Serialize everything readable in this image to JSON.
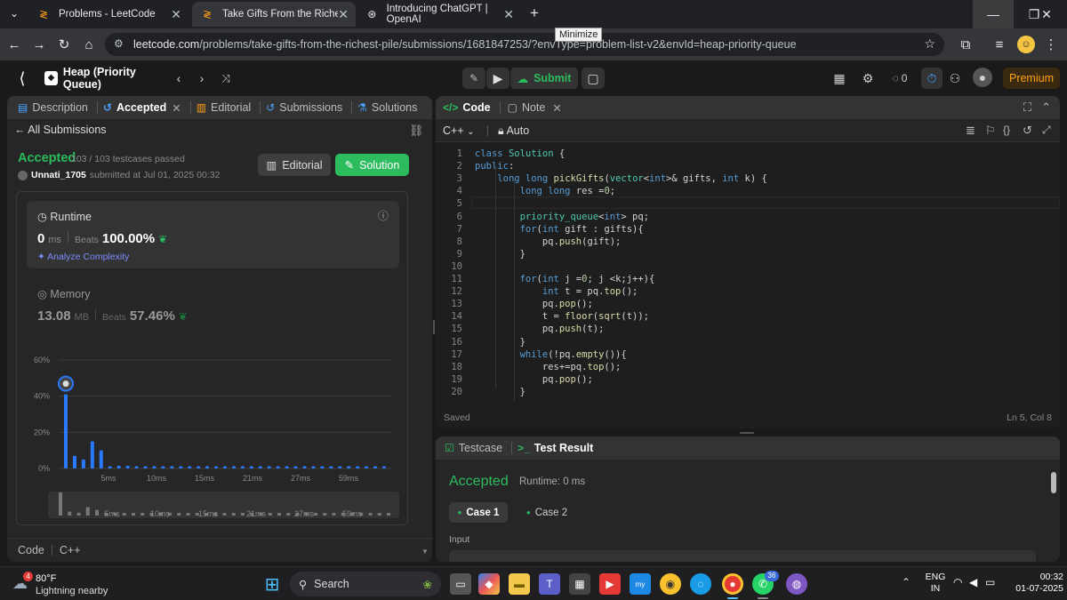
{
  "browser": {
    "tabs": [
      {
        "title": "Problems - LeetCode",
        "active": false
      },
      {
        "title": "Take Gifts From the Richest Pile",
        "active": true
      },
      {
        "title": "Introducing ChatGPT | OpenAI",
        "active": false
      }
    ],
    "tooltip": "Minimize",
    "url_host": "leetcode.com",
    "url_path": "/problems/take-gifts-from-the-richest-pile/submissions/1681847253/?envType=problem-list-v2&envId=heap-priority-queue"
  },
  "header": {
    "problem_list": "Heap (Priority Queue)",
    "submit_label": "Submit",
    "streak_count": "0",
    "premium_label": "Premium"
  },
  "left_panel": {
    "tabs": [
      {
        "label": "Description"
      },
      {
        "label": "Accepted"
      },
      {
        "label": "Editorial"
      },
      {
        "label": "Submissions"
      },
      {
        "label": "Solutions"
      }
    ],
    "back_label": "All Submissions",
    "status": "Accepted",
    "testcases": "103 / 103 testcases passed",
    "user": "Unnati_1705",
    "submitted_text": "submitted at Jul 01, 2025 00:32",
    "editorial_btn": "Editorial",
    "solution_btn": "Solution",
    "runtime": {
      "title": "Runtime",
      "value": "0",
      "unit": "ms",
      "beats_label": "Beats",
      "beats_value": "100.00%",
      "analyze": "Analyze Complexity"
    },
    "memory": {
      "title": "Memory",
      "value": "13.08",
      "unit": "MB",
      "beats_label": "Beats",
      "beats_value": "57.46%"
    },
    "footer_tabs": [
      "Code",
      "C++"
    ]
  },
  "chart_data": {
    "type": "bar",
    "y_ticks": [
      "60%",
      "40%",
      "20%",
      "0%"
    ],
    "ylim": [
      0,
      60
    ],
    "x_ticks": [
      "5ms",
      "10ms",
      "15ms",
      "21ms",
      "27ms",
      "59ms"
    ],
    "values": [
      41,
      7,
      5,
      15,
      10,
      1,
      1.5,
      1.5,
      1,
      1,
      1,
      1,
      1,
      1,
      1,
      1,
      1,
      1,
      1,
      1,
      1,
      1,
      1,
      1,
      1,
      1,
      1,
      1,
      1,
      1,
      1,
      1,
      1,
      1,
      1,
      1,
      1
    ],
    "highlight_index": 0,
    "bar_color": "#2979ff"
  },
  "code_panel": {
    "tabs": [
      {
        "label": "Code"
      },
      {
        "label": "Note"
      }
    ],
    "language": "C++",
    "auto_label": "Auto",
    "status": "Saved",
    "cursor": "Ln 5, Col 8",
    "lines": [
      "class Solution {",
      "public:",
      "    long long pickGifts(vector<int>& gifts, int k) {",
      "        long long res =0;",
      "",
      "        priority_queue<int> pq;",
      "        for(int gift : gifts){",
      "            pq.push(gift);",
      "        }",
      "",
      "        for(int j =0; j <k;j++){",
      "            int t = pq.top();",
      "            pq.pop();",
      "            t = floor(sqrt(t));",
      "            pq.push(t);",
      "        }",
      "        while(!pq.empty()){",
      "            res+=pq.top();",
      "            pq.pop();",
      "        }"
    ]
  },
  "result_panel": {
    "tabs": [
      {
        "label": "Testcase"
      },
      {
        "label": "Test Result"
      }
    ],
    "status": "Accepted",
    "runtime": "Runtime: 0 ms",
    "cases": [
      "Case 1",
      "Case 2"
    ],
    "input_label": "Input"
  },
  "taskbar": {
    "weather_temp": "80°F",
    "weather_desc": "Lightning nearby",
    "weather_badge": "4",
    "search_label": "Search",
    "lang_top": "ENG",
    "lang_bottom": "IN",
    "time": "00:32",
    "date": "01-07-2025",
    "whatsapp_badge": "36"
  }
}
